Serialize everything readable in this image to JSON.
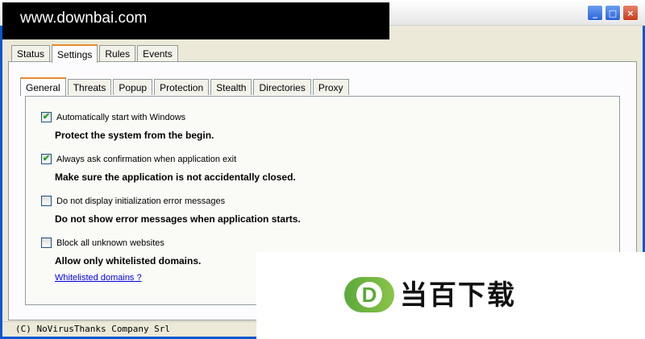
{
  "watermark": {
    "site": "www.downbai.com",
    "logo_letter": "D",
    "logo_text": "当百下载"
  },
  "window": {
    "controls": {
      "minimize": "_",
      "maximize": "□",
      "close": "×"
    }
  },
  "tabs": [
    {
      "label": "Status",
      "active": false
    },
    {
      "label": "Settings",
      "active": true
    },
    {
      "label": "Rules",
      "active": false
    },
    {
      "label": "Events",
      "active": false
    }
  ],
  "subtabs": [
    {
      "label": "General",
      "active": true
    },
    {
      "label": "Threats",
      "active": false
    },
    {
      "label": "Popup",
      "active": false
    },
    {
      "label": "Protection",
      "active": false
    },
    {
      "label": "Stealth",
      "active": false
    },
    {
      "label": "Directories",
      "active": false
    },
    {
      "label": "Proxy",
      "active": false
    }
  ],
  "options": [
    {
      "label": "Automatically start with Windows",
      "checked": true,
      "desc": "Protect the system from the begin."
    },
    {
      "label": "Always ask confirmation when application exit",
      "checked": true,
      "desc": "Make sure the application is not accidentally closed."
    },
    {
      "label": "Do not display initialization error messages",
      "checked": false,
      "desc": "Do not show error messages when application starts."
    },
    {
      "label": "Block all unknown websites",
      "checked": false,
      "desc": "Allow only whitelisted domains."
    }
  ],
  "whitelist_link": "Whitelisted domains ?",
  "status": {
    "text": "(C) NoVirusThanks Company Srl"
  },
  "colors": {
    "checkmark": "#21a121",
    "active_tab_border": "#e68b2c",
    "link": "#0000ee",
    "title_blue": "#0b57d0"
  },
  "icons": {
    "check": "✔"
  }
}
